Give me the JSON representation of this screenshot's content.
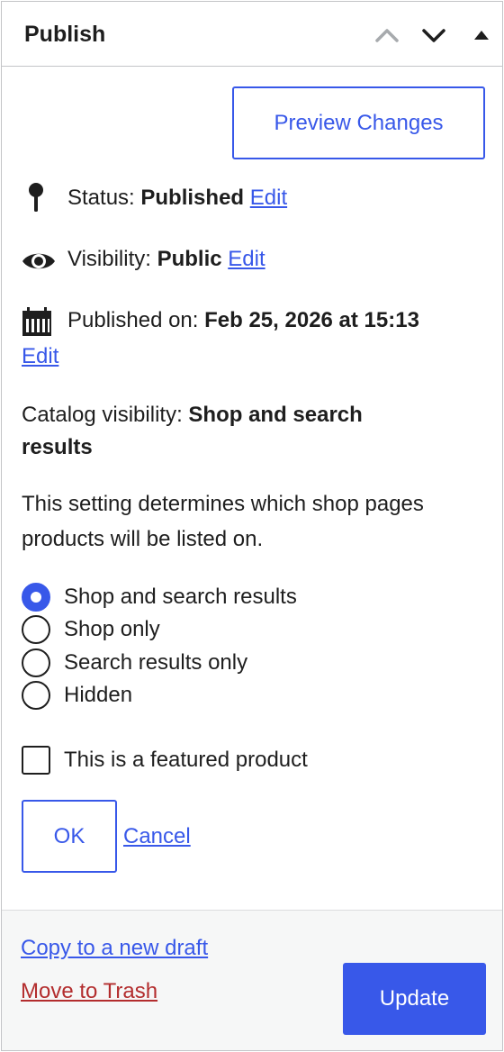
{
  "header": {
    "title": "Publish",
    "move_up_icon": "chevron-up-icon",
    "move_down_icon": "chevron-down-icon",
    "toggle_icon": "triangle-up-icon"
  },
  "preview_button": "Preview Changes",
  "status": {
    "icon": "pin-icon",
    "label": "Status:",
    "value": "Published",
    "edit": "Edit"
  },
  "visibility": {
    "icon": "eye-icon",
    "label": "Visibility:",
    "value": "Public",
    "edit": "Edit"
  },
  "published_on": {
    "icon": "calendar-icon",
    "label": "Published on:",
    "value": "Feb 25, 2026 at 15:13",
    "edit": "Edit"
  },
  "catalog_visibility": {
    "label": "Catalog visibility:",
    "value_line1": "Shop and search",
    "value_line2": "results",
    "description_line1": "This setting determines which shop pages",
    "description_line2": "products will be listed on.",
    "options": [
      {
        "label": "Shop and search results",
        "checked": true
      },
      {
        "label": "Shop only",
        "checked": false
      },
      {
        "label": "Search results only",
        "checked": false
      },
      {
        "label": "Hidden",
        "checked": false
      }
    ],
    "featured_label": "This is a featured product",
    "featured_checked": false,
    "ok_label": "OK",
    "cancel_label": "Cancel"
  },
  "footer": {
    "copy_label": "Copy to a new draft",
    "trash_label": "Move to Trash",
    "update_label": "Update"
  },
  "colors": {
    "accent": "#3858e9",
    "danger": "#b32d2e",
    "footer_bg": "#f6f7f7",
    "border": "#c3c4c7"
  }
}
